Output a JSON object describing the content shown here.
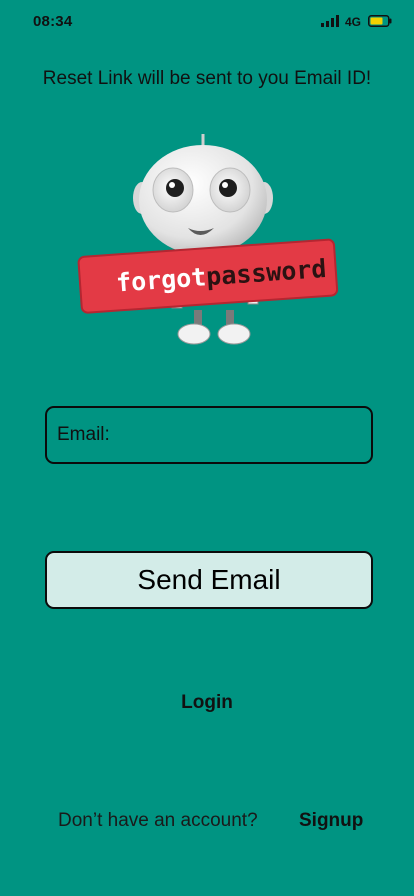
{
  "status_bar": {
    "time": "08:34",
    "network": "4G",
    "signal_icon": "cellular-signal-icon",
    "battery_icon": "battery-icon",
    "battery_color": "#f2d100"
  },
  "header": {
    "subtitle": "Reset Link will be sent to you Email ID!"
  },
  "illustration": {
    "sign_text_part1": "forgot",
    "sign_text_part2": "password",
    "sign_color": "#e33a45"
  },
  "form": {
    "email_label": "Email:",
    "email_value": "",
    "send_button_label": "Send Email",
    "login_label": "Login"
  },
  "footer": {
    "question": "Don’t have an account?",
    "signup_label": "Signup"
  },
  "colors": {
    "background": "#009482",
    "button_fill": "#d3ece8",
    "border": "#0b0b0b"
  }
}
